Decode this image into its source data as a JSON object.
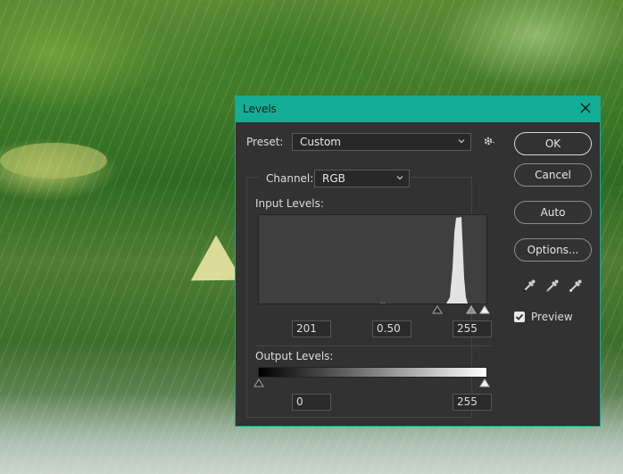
{
  "dialog": {
    "title": "Levels"
  },
  "preset": {
    "label": "Preset:",
    "value": "Custom"
  },
  "channel": {
    "label": "Channel:",
    "value": "RGB"
  },
  "input_levels": {
    "label": "Input Levels:",
    "black": "201",
    "gamma": "0.50",
    "white": "255"
  },
  "output_levels": {
    "label": "Output Levels:",
    "black": "0",
    "white": "255"
  },
  "buttons": {
    "ok": "OK",
    "cancel": "Cancel",
    "auto": "Auto",
    "options": "Options..."
  },
  "preview": {
    "label": "Preview",
    "checked": true
  },
  "icons": {
    "close": "close-icon",
    "gear": "gear-icon",
    "eyedroppers": [
      "black-point-eyedropper-icon",
      "gray-point-eyedropper-icon",
      "white-point-eyedropper-icon"
    ]
  },
  "colors": {
    "titlebar": "#14ad96",
    "dialog_bg": "#323232"
  }
}
